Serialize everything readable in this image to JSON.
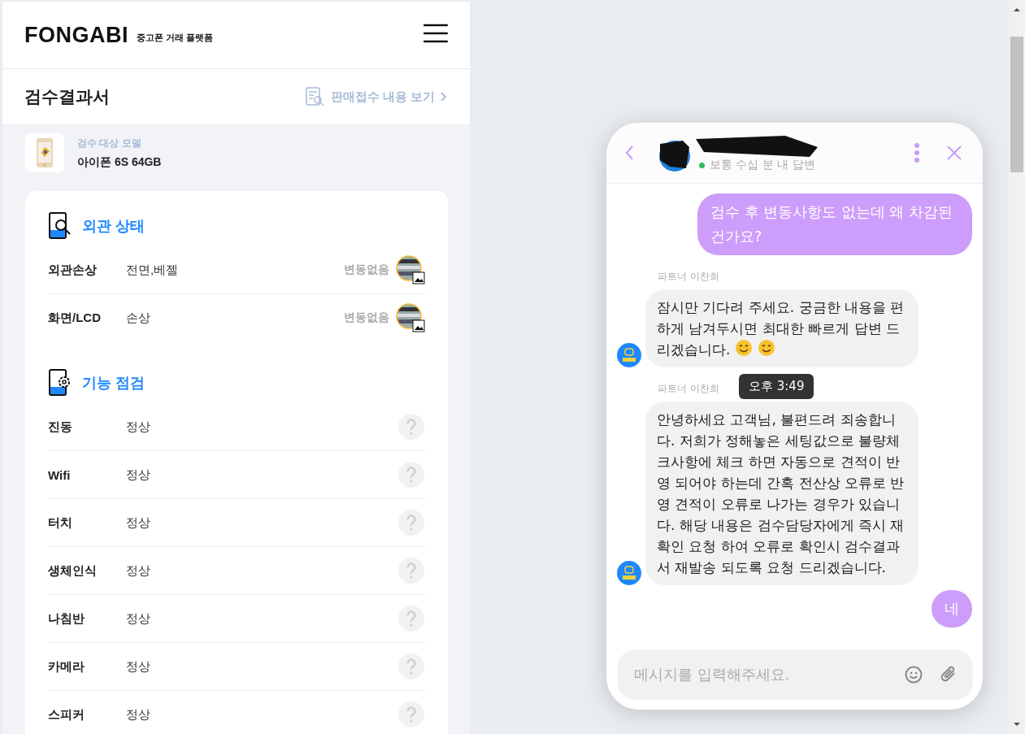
{
  "header": {
    "logo": "FONGABI",
    "tagline": "중고폰 거래 플랫폼"
  },
  "report": {
    "title": "검수결과서",
    "link": "판매접수 내용 보기"
  },
  "model": {
    "label": "검수 대상 모델",
    "name": "아이폰 6S 64GB"
  },
  "sections": [
    {
      "title": "외관 상태",
      "rows": [
        {
          "label": "외관손상",
          "value": "전면,베젤",
          "status": "변동없음"
        },
        {
          "label": "화면/LCD",
          "value": "손상",
          "status": "변동없음"
        }
      ]
    },
    {
      "title": "기능 점검",
      "rows": [
        {
          "kind": "help",
          "label": "진동",
          "value": "정상"
        },
        {
          "kind": "help",
          "label": "Wifi",
          "value": "정상"
        },
        {
          "kind": "help",
          "label": "터치",
          "value": "정상"
        },
        {
          "kind": "help",
          "label": "생체인식",
          "value": "정상"
        },
        {
          "kind": "help",
          "label": "나침반",
          "value": "정상"
        },
        {
          "kind": "help",
          "label": "카메라",
          "value": "정상"
        },
        {
          "kind": "help",
          "label": "스피커",
          "value": "정상"
        }
      ]
    }
  ],
  "chat": {
    "status": "보통 수십 분 내 답변",
    "messages": [
      {
        "kind": "sent",
        "text": "검수 후 변동사항도 없는데 왜 차감된건가요?"
      },
      {
        "kind": "received",
        "sender": "파트너 이찬희",
        "text": "잠시만 기다려 주세요. 궁금한 내용을 편하게 남겨두시면 최대한 빠르게 답변 드리겠습니다.",
        "emoji": true
      },
      {
        "kind": "received",
        "sender": "파트너 이찬희",
        "text": "안녕하세요 고객님, 불편드려 죄송합니다. 저희가 정해놓은 세팅값으로 불량체크사항에 체크 하면 자동으로 견적이 반영 되어야 하는데 간혹 전산상 오류로 반영 견적이 오류로 나가는 경우가 있습니다. 해당 내용은 검수담당자에게 즉시 재확인 요청 하여 오류로 확인시 검수결과서 재발송 되도록 요청 드리겠습니다."
      },
      {
        "kind": "sent",
        "text": "네"
      }
    ],
    "tooltip": "오후 3:49",
    "input": {
      "placeholder": "메시지를 입력해주세요."
    }
  }
}
